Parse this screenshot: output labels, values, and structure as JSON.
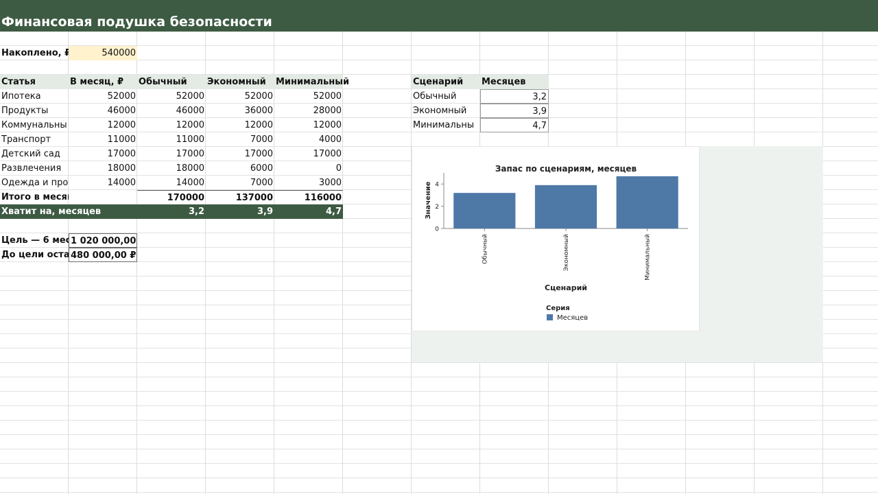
{
  "title": "Финансовая подушка безопасности",
  "savings": {
    "label": "Накоплено, ₽",
    "value": "540000"
  },
  "table": {
    "headers": [
      "Статья",
      "В месяц, ₽",
      "Обычный",
      "Экономный",
      "Минимальный"
    ],
    "rows": [
      [
        "Ипотека",
        "52000",
        "52000",
        "52000",
        "52000"
      ],
      [
        "Продукты",
        "46000",
        "46000",
        "36000",
        "28000"
      ],
      [
        "Коммунальны",
        "12000",
        "12000",
        "12000",
        "12000"
      ],
      [
        "Транспорт",
        "11000",
        "11000",
        "7000",
        "4000"
      ],
      [
        "Детский сад",
        "17000",
        "17000",
        "17000",
        "17000"
      ],
      [
        "Развлечения",
        "18000",
        "18000",
        "6000",
        "0"
      ],
      [
        "Одежда и про",
        "14000",
        "14000",
        "7000",
        "3000"
      ]
    ],
    "total": {
      "label": "Итого в месяц",
      "values": [
        "170000",
        "137000",
        "116000"
      ]
    },
    "months": {
      "label": "Хватит на, месяцев",
      "values": [
        "3,2",
        "3,9",
        "4,7"
      ]
    }
  },
  "goal": {
    "label": "Цель — 6 мес",
    "value": "1 020 000,00 ₽"
  },
  "remaining": {
    "label": "До цели оста",
    "value": "480 000,00 ₽"
  },
  "scenarios": {
    "headers": [
      "Сценарий",
      "Месяцев"
    ],
    "rows": [
      [
        "Обычный",
        "3,2"
      ],
      [
        "Экономный",
        "3,9"
      ],
      [
        "Минимальны",
        "4,7"
      ]
    ]
  },
  "colors": {
    "header_green": "#3d5b43",
    "bar_blue": "#4e79a7",
    "input_yellow": "#fff2cc",
    "header_fill": "#e3ebe4"
  },
  "chart_data": {
    "type": "bar",
    "title": "Запас по сценариям, месяцев",
    "xlabel": "Сценарий",
    "ylabel": "Значение",
    "categories": [
      "Обычный",
      "Экономный",
      "Минимальный"
    ],
    "series": [
      {
        "name": "Месяцев",
        "values": [
          3.2,
          3.9,
          4.7
        ]
      }
    ],
    "ylim": [
      0,
      5
    ],
    "yticks": [
      "0",
      "2",
      "4"
    ],
    "legend_title": "Серия",
    "legend_position": "bottom-left",
    "grid": false
  }
}
